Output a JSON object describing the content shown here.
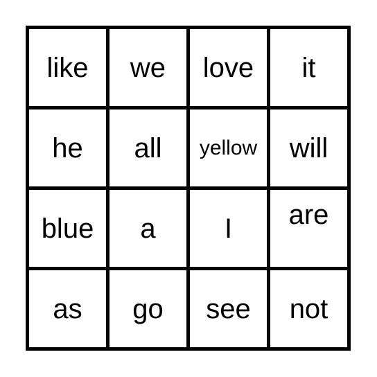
{
  "board": {
    "rows": [
      [
        {
          "word": "like"
        },
        {
          "word": "we"
        },
        {
          "word": "love"
        },
        {
          "word": "it"
        }
      ],
      [
        {
          "word": "he"
        },
        {
          "word": "all"
        },
        {
          "word": "yellow"
        },
        {
          "word": "will"
        }
      ],
      [
        {
          "word": "blue"
        },
        {
          "word": "a"
        },
        {
          "word": "I"
        },
        {
          "word": "are"
        }
      ],
      [
        {
          "word": "as"
        },
        {
          "word": "go"
        },
        {
          "word": "see"
        },
        {
          "word": "not"
        }
      ]
    ]
  }
}
